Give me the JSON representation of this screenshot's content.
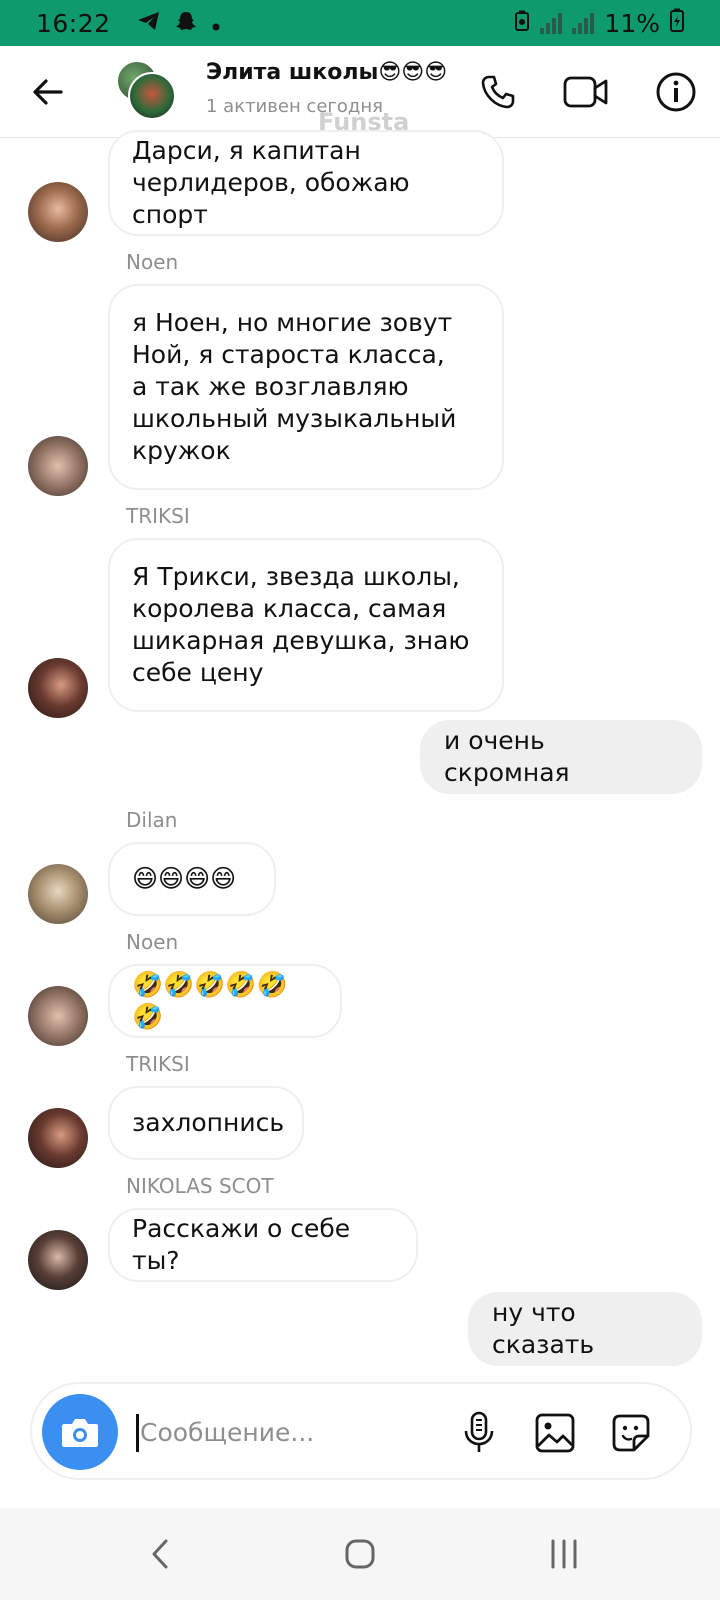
{
  "status_bar": {
    "time": "16:22",
    "battery": "11%",
    "left_icons": [
      "telegram-icon",
      "snapchat-icon",
      "dot-icon"
    ],
    "right_icons": [
      "battery-saver-icon",
      "signal-icon",
      "signal-icon",
      "battery-icon"
    ],
    "background": "#0f9a6e"
  },
  "header": {
    "title": "Элита школы😎😎😎",
    "subtitle": "1 активен сегодня",
    "watermark": "Funsta",
    "icons": [
      "back-arrow-icon",
      "phone-icon",
      "video-icon",
      "info-icon"
    ]
  },
  "messages": [
    {
      "sender": "",
      "text": "Дарси, я капитан\nчерлидеров, обожаю спорт",
      "direction": "in",
      "avatar": "girl"
    },
    {
      "sender": "Noen",
      "text": "я Ноен, но многие зовут\nНой, я староста класса,\nа так же возглавляю\nшкольный музыкальный\nкружок",
      "direction": "in",
      "avatar": "noen"
    },
    {
      "sender": "TRIKSI",
      "text": "Я Трикси, звезда школы,\nкоролева класса, самая\nшикарная девушка, знаю\nсебе цену",
      "direction": "in",
      "avatar": "triksi"
    },
    {
      "sender": "",
      "text": "и очень скромная",
      "direction": "out"
    },
    {
      "sender": "Dilan",
      "text": "😄😄😄😄",
      "direction": "in",
      "avatar": "dilan"
    },
    {
      "sender": "Noen",
      "text": "🤣🤣🤣🤣🤣🤣",
      "direction": "in",
      "avatar": "noen"
    },
    {
      "sender": "TRIKSI",
      "text": "захлопнись",
      "direction": "in",
      "avatar": "triksi"
    },
    {
      "sender": "NIKOLAS SCOT",
      "text": "Расскажи о себе ты?",
      "direction": "in",
      "avatar": "nikolas"
    },
    {
      "sender": "",
      "text": "ну что сказать",
      "direction": "out"
    }
  ],
  "composer": {
    "placeholder": "Сообщение...",
    "value": "",
    "icons": [
      "camera-icon",
      "microphone-icon",
      "gallery-icon",
      "sticker-icon"
    ],
    "camera_color": "#3a8ff0"
  },
  "nav_bar": {
    "icons": [
      "nav-back-icon",
      "nav-home-icon",
      "nav-recents-icon"
    ]
  }
}
